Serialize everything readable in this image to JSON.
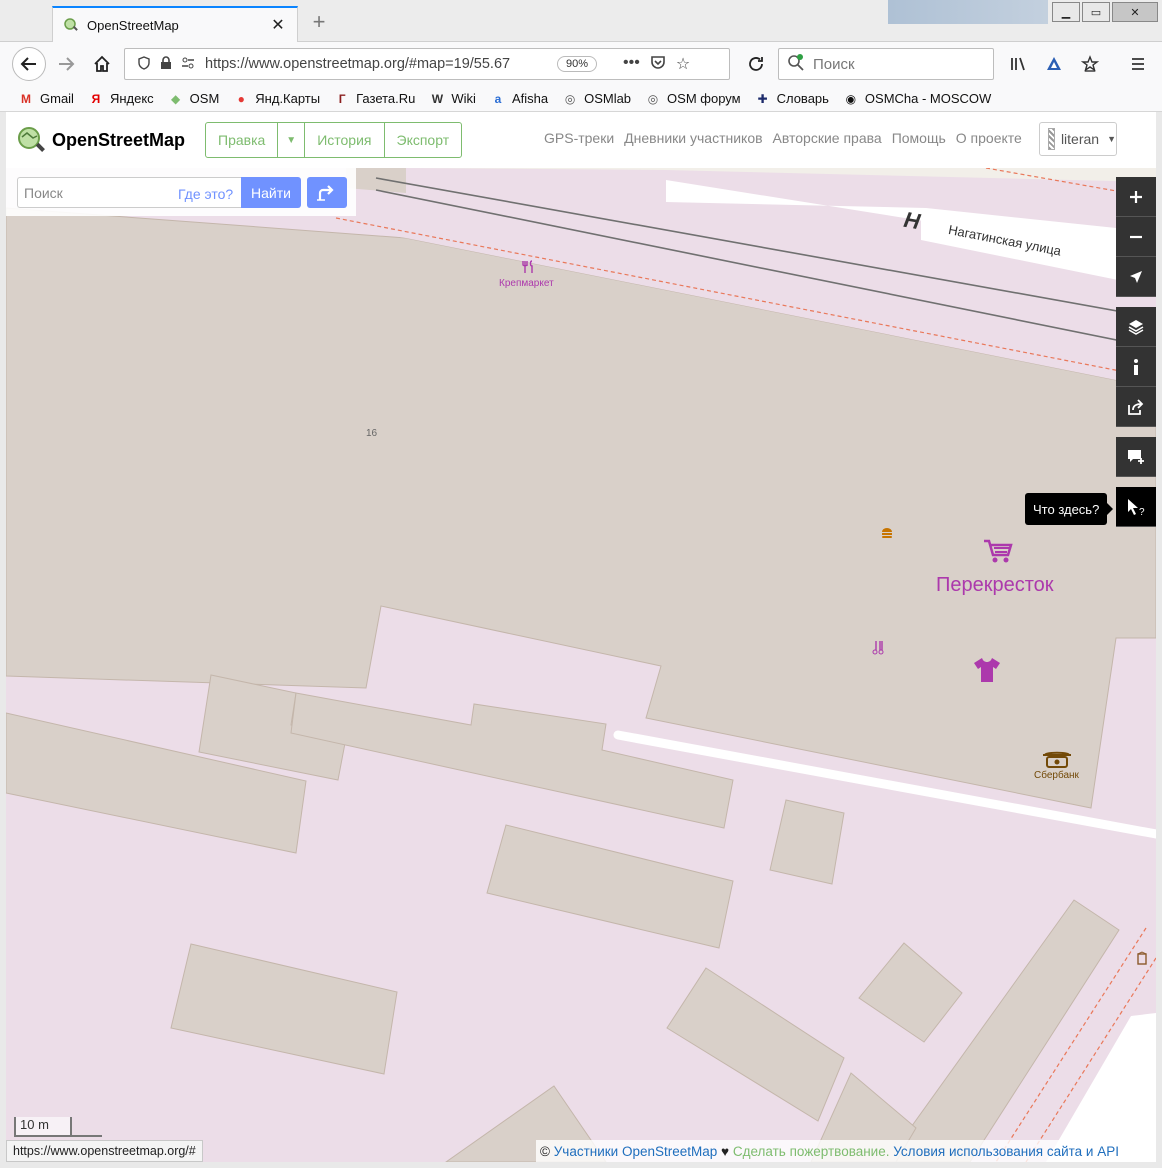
{
  "browser": {
    "tab_title": "OpenStreetMap",
    "new_tab_symbol": "+",
    "url": "https://www.openstreetmap.org/#map=19/55.67",
    "zoom": "90%",
    "search_placeholder": "Поиск"
  },
  "bookmarks": [
    {
      "label": "Gmail",
      "icon": "M",
      "color": "#d93025"
    },
    {
      "label": "Яндекс",
      "icon": "Я",
      "color": "#e30000"
    },
    {
      "label": "OSM",
      "icon": "◆",
      "color": "#7ebc6f"
    },
    {
      "label": "Янд.Карты",
      "icon": "●",
      "color": "#e53935"
    },
    {
      "label": "Газета.Ru",
      "icon": "Г",
      "color": "#8b1e1e"
    },
    {
      "label": "Wiki",
      "icon": "W",
      "color": "#333333"
    },
    {
      "label": "Afisha",
      "icon": "a",
      "color": "#2a6dd4"
    },
    {
      "label": "OSMlab",
      "icon": "◎",
      "color": "#555555"
    },
    {
      "label": "OSM форум",
      "icon": "◎",
      "color": "#555555"
    },
    {
      "label": "Словарь",
      "icon": "✚",
      "color": "#1d2b6b"
    },
    {
      "label": "OSMCha - MOSCOW",
      "icon": "◉",
      "color": "#111111"
    }
  ],
  "osm": {
    "brand": "OpenStreetMap",
    "edit": "Правка",
    "history": "История",
    "export": "Экспорт",
    "links": [
      "GPS-треки",
      "Дневники участников",
      "Авторские права",
      "Помощь",
      "О проекте"
    ],
    "user": "literan"
  },
  "search": {
    "placeholder": "Поиск",
    "where": "Где это?",
    "find": "Найти"
  },
  "map": {
    "street": "Нагатинская улица",
    "street_fragment": "Н",
    "poi_krepmarket": "Крепмаркет",
    "poi_perekrestok": "Перекресток",
    "poi_sberbank": "Сбербанк",
    "house_number": "16",
    "tooltip": "Что здесь?",
    "scale": "10 m",
    "colors": {
      "building": "#d9d0c9",
      "landuse": "#ecdde8",
      "road": "#ffffff",
      "rail": "#707070",
      "shop": "#ac39ac",
      "bank": "#734a08"
    }
  },
  "attribution": {
    "prefix": "©",
    "contributors": "Участники OpenStreetMap",
    "heart": "♥",
    "donate": "Сделать пожертвование.",
    "terms": "Условия использования сайта и API"
  },
  "status": "https://www.openstreetmap.org/#"
}
